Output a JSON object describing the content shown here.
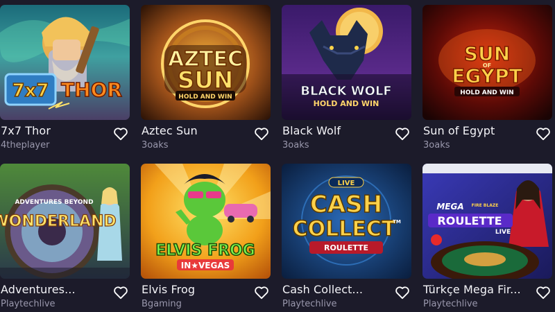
{
  "games": [
    {
      "title": "7x7 Thor",
      "provider": "4theplayer",
      "art": {
        "line1": "7x7",
        "line2": "THOR"
      }
    },
    {
      "title": "Aztec Sun",
      "provider": "3oaks",
      "art": {
        "line1": "AZTEC",
        "line2": "SUN",
        "tag": "HOLD AND WIN"
      }
    },
    {
      "title": "Black Wolf",
      "provider": "3oaks",
      "art": {
        "line1": "BLACK WOLF",
        "tag": "HOLD AND WIN"
      }
    },
    {
      "title": "Sun of Egypt",
      "provider": "3oaks",
      "art": {
        "line1": "SUN",
        "small": "OF",
        "line2": "EGYPT",
        "tag": "HOLD AND WIN"
      }
    },
    {
      "title": "Adventures...",
      "provider": "Playtechlive",
      "art": {
        "top": "ADVENTURES BEYOND",
        "line1": "WONDERLAND"
      }
    },
    {
      "title": "Elvis Frog",
      "provider": "Bgaming",
      "art": {
        "line1": "ELVIS FROG",
        "line2": "IN★VEGAS"
      }
    },
    {
      "title": "Cash Collect...",
      "provider": "Playtechlive",
      "art": {
        "top": "LIVE",
        "line1": "CASH",
        "line2": "COLLECT",
        "tm": "TM",
        "tag": "ROULETTE"
      }
    },
    {
      "title": "Türkçe Mega Fir...",
      "provider": "Playtechlive",
      "art": {
        "line1": "MEGA",
        "small": "FIRE BLAZE",
        "line2": "ROULETTE",
        "tag": "LIVE"
      }
    }
  ]
}
